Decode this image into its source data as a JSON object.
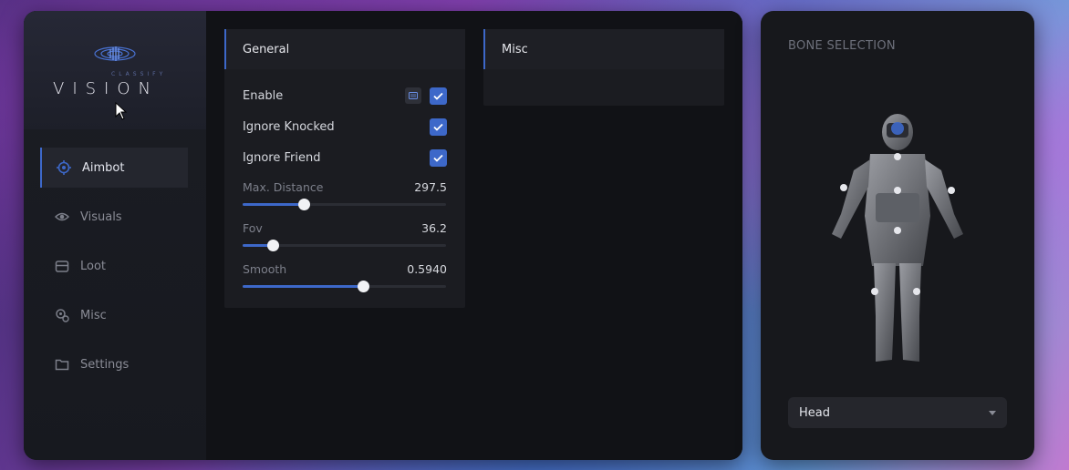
{
  "app": {
    "logo_sub": "CLASSIFY",
    "logo_name": "VISION"
  },
  "sidebar": {
    "items": [
      {
        "label": "Aimbot",
        "icon": "target-icon",
        "active": true
      },
      {
        "label": "Visuals",
        "icon": "eye-icon",
        "active": false
      },
      {
        "label": "Loot",
        "icon": "chest-icon",
        "active": false
      },
      {
        "label": "Misc",
        "icon": "gear-puzzle-icon",
        "active": false
      },
      {
        "label": "Settings",
        "icon": "folder-icon",
        "active": false
      }
    ]
  },
  "general": {
    "title": "General",
    "toggles": [
      {
        "label": "Enable",
        "checked": true,
        "has_keybind": true
      },
      {
        "label": "Ignore Knocked",
        "checked": true,
        "has_keybind": false
      },
      {
        "label": "Ignore Friend",
        "checked": true,
        "has_keybind": false
      }
    ],
    "sliders": [
      {
        "label": "Max. Distance",
        "value": "297.5",
        "fraction": 0.3
      },
      {
        "label": "Fov",
        "value": "36.2",
        "fraction": 0.15
      },
      {
        "label": "Smooth",
        "value": "0.5940",
        "fraction": 0.59
      }
    ]
  },
  "misc": {
    "title": "Misc"
  },
  "bone_selection": {
    "title": "BONE SELECTION",
    "selected": "Head"
  },
  "colors": {
    "accent": "#3d68c9",
    "panel": "#111216",
    "sidebar": "#1b1d24"
  }
}
